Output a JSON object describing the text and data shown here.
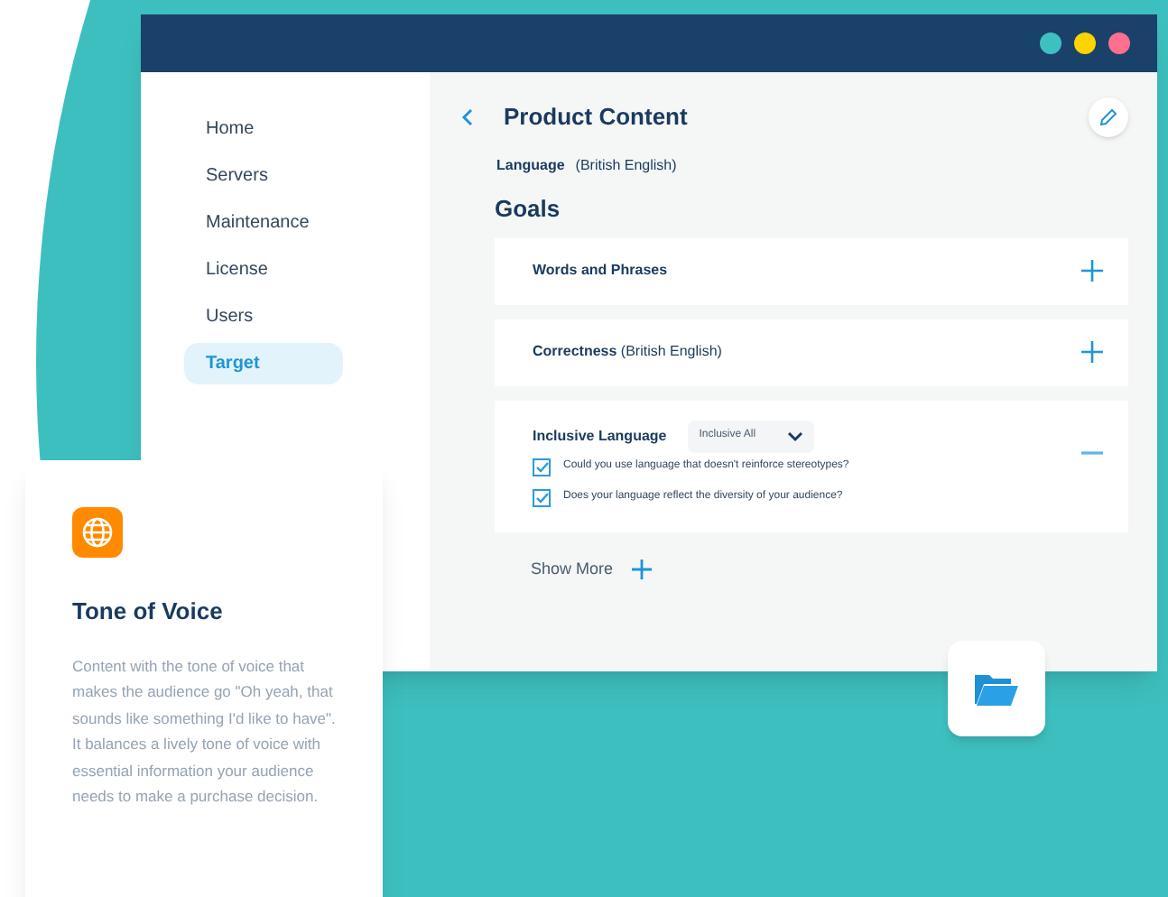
{
  "window": {
    "dots": [
      {
        "color": "#3ec0c0"
      },
      {
        "color": "#fdd300"
      },
      {
        "color": "#ff6f8f"
      }
    ],
    "sidebar": {
      "items": [
        {
          "label": "Home",
          "selected": false
        },
        {
          "label": "Servers",
          "selected": false
        },
        {
          "label": "Maintenance",
          "selected": false
        },
        {
          "label": "License",
          "selected": false
        },
        {
          "label": "Users",
          "selected": false
        },
        {
          "label": "Target",
          "selected": true
        }
      ]
    },
    "content": {
      "title": "Product Content",
      "language": {
        "label": "Language",
        "value": "(British English)"
      },
      "section_title": "Goals",
      "goals": [
        {
          "title": "Words and Phrases",
          "expanded": false
        },
        {
          "title": "Correctness",
          "note": "(British English)",
          "expanded": false
        },
        {
          "title": "Inclusive Language",
          "dropdown": "Inclusive All",
          "expanded": true,
          "checks": [
            {
              "label": "Could you use language that doesn't reinforce stereotypes?",
              "checked": true
            },
            {
              "label": "Does your language reflect the diversity of your audience?",
              "checked": true
            }
          ]
        }
      ],
      "show_more": "Show More"
    }
  },
  "card": {
    "title": "Tone of Voice",
    "body": "Content with the tone of voice that makes the audience go \"Oh yeah, that sounds like something I'd like to have\". It balances a lively tone of voice with essential information your audience needs to make a purchase decision."
  }
}
